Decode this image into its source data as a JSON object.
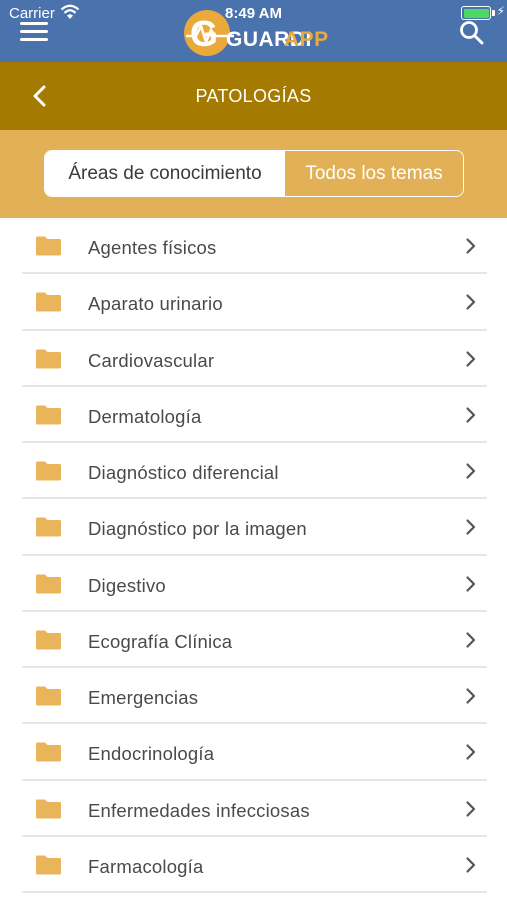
{
  "status_bar": {
    "carrier": "Carrier",
    "time": "8:49 AM"
  },
  "app": {
    "logo_left": "GUARDI",
    "logo_right": "APP",
    "logo_letter": "G"
  },
  "header": {
    "title": "PATOLOGÍAS"
  },
  "segments": [
    {
      "label": "Áreas de conocimiento",
      "selected": false
    },
    {
      "label": "Todos los temas",
      "selected": true
    }
  ],
  "list": {
    "items": [
      {
        "label": "Agentes físicos"
      },
      {
        "label": "Aparato urinario"
      },
      {
        "label": "Cardiovascular"
      },
      {
        "label": "Dermatología"
      },
      {
        "label": "Diagnóstico diferencial"
      },
      {
        "label": "Diagnóstico por la imagen"
      },
      {
        "label": "Digestivo"
      },
      {
        "label": "Ecografía Clínica"
      },
      {
        "label": "Emergencias"
      },
      {
        "label": "Endocrinología"
      },
      {
        "label": "Enfermedades infecciosas"
      },
      {
        "label": "Farmacología"
      }
    ]
  },
  "colors": {
    "appbar": "#4a72ad",
    "titlebar": "#a57a00",
    "segbar": "#e2b157",
    "folder": "#e9b45a"
  },
  "icons": {
    "menu": "hamburger-icon",
    "search": "search-icon",
    "back": "chevron-left-icon",
    "folder": "folder-icon",
    "chevron": "chevron-right-icon"
  }
}
